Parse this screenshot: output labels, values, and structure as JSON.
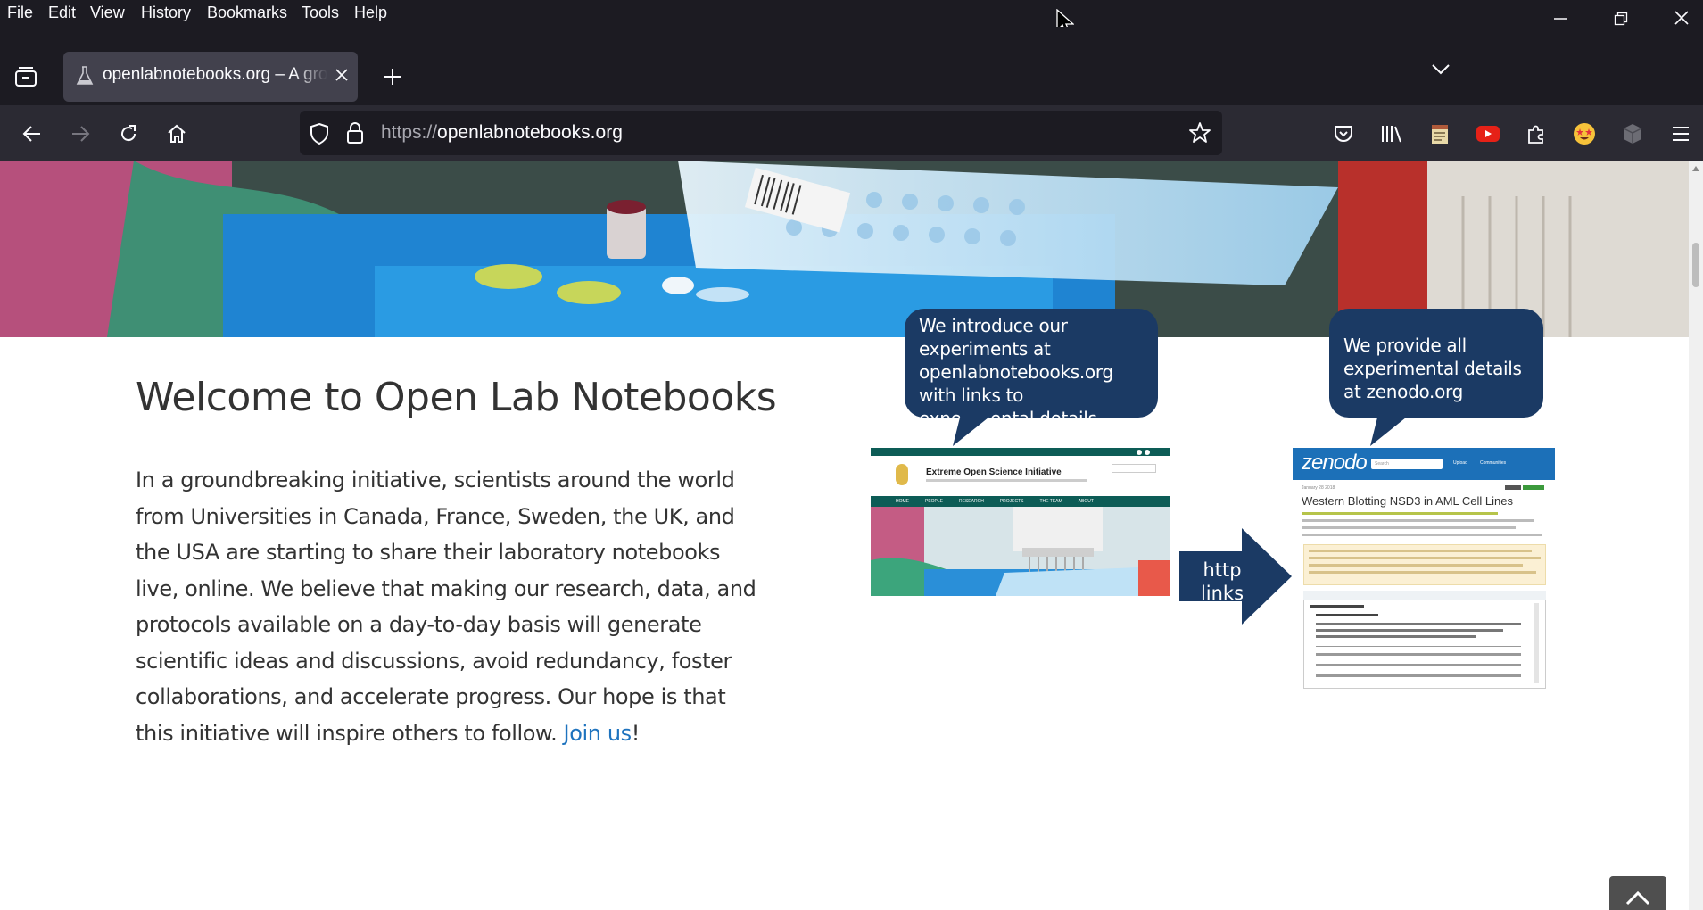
{
  "menubar": {
    "items": [
      "File",
      "Edit",
      "View",
      "History",
      "Bookmarks",
      "Tools",
      "Help"
    ]
  },
  "tab": {
    "title": "openlabnotebooks.org – A growing initiative"
  },
  "urlbar": {
    "scheme": "https://",
    "host": "openlabnotebooks.org"
  },
  "main": {
    "title": "Welcome to Open Lab Notebooks",
    "intro_text": "In a groundbreaking initiative, scientists around the world from Universities in Canada, France, Sweden, the UK, and the USA are starting to share their laboratory notebooks live, online. We believe that making our research, data, and protocols available on a day-to-day basis will generate scientific ideas and discussions, avoid redundancy, foster collaborations, and accelerate progress. Our hope is that this initiative will inspire others to follow. ",
    "join_link": "Join us",
    "join_suffix": "!"
  },
  "diagram": {
    "bubble_left": "We introduce our experiments at openlabnotebooks.org with links to experimental details",
    "bubble_right": "We provide all experimental details at zenodo.org",
    "arrow_label": "http links",
    "eosi_title": "Extreme Open Science Initiative",
    "eosi_nav": [
      "HOME",
      "PEOPLE",
      "RESEARCH",
      "PROJECTS",
      "THE TEAM",
      "ABOUT"
    ],
    "zenodo_logo": "zenodo",
    "zenodo_nav": [
      "Upload",
      "Communities"
    ],
    "zenodo_search": "Search",
    "zenodo_date": "January 28 2018",
    "zenodo_title": "Western Blotting NSD3 in AML Cell Lines"
  },
  "colors": {
    "chrome_dark": "#1c1b22",
    "toolbar": "#2b2a33",
    "bubble": "#1b3a64",
    "link": "#1e73be",
    "zenodo_blue": "#1c70b8"
  }
}
